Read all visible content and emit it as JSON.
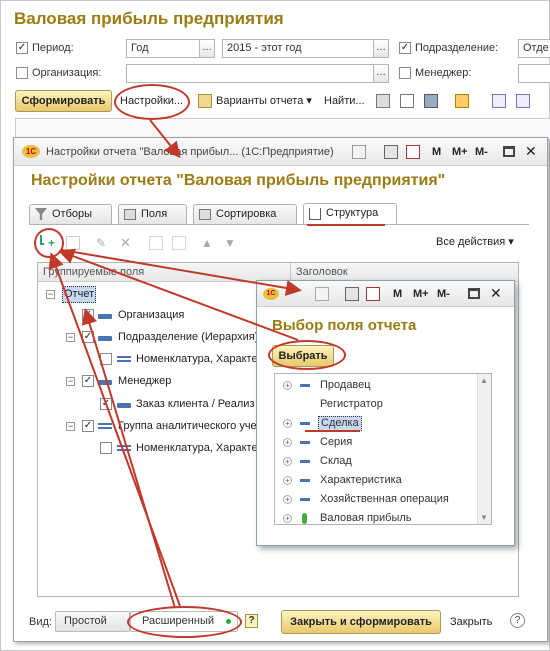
{
  "main": {
    "title": "Валовая прибыль предприятия",
    "period_label": "Период:",
    "period_value": "Год",
    "period_range": "2015 - этот год",
    "division_label": "Подразделение:",
    "division_value": "Отде",
    "org_label": "Организация:",
    "manager_label": "Менеджер:",
    "toolbar": {
      "generate": "Сформировать",
      "settings": "Настройки...",
      "variants": "Варианты отчета",
      "find": "Найти..."
    }
  },
  "settings_window": {
    "titlebar": "Настройки отчета \"Валовая прибыл... (1С:Предприятие)",
    "heading": "Настройки отчета \"Валовая прибыль предприятия\"",
    "tabs": [
      "Отборы",
      "Поля",
      "Сортировка",
      "Структура"
    ],
    "all_actions": "Все действия",
    "columns": {
      "grouped": "Группируемые поля",
      "header": "Заголовок"
    },
    "tree": [
      {
        "label": "Отчет"
      },
      {
        "label": "Организация"
      },
      {
        "label": "Подразделение (Иерархия)"
      },
      {
        "label": "Номенклатура, Характе"
      },
      {
        "label": "Менеджер"
      },
      {
        "label": "Заказ клиента / Реализ"
      },
      {
        "label": "Группа аналитического уче"
      },
      {
        "label": "Номенклатура, Характе"
      }
    ],
    "view_label": "Вид:",
    "view_simple": "Простой",
    "view_extended": "Расширенный",
    "help": "?",
    "close_generate": "Закрыть и сформировать",
    "close": "Закрыть"
  },
  "popup": {
    "heading": "Выбор поля отчета",
    "select_button": "Выбрать",
    "items": [
      "Продавец",
      "Регистратор",
      "Сделка",
      "Серия",
      "Склад",
      "Характеристика",
      "Хозяйственная операция",
      "Валовая прибыль"
    ]
  },
  "window_buttons": {
    "m": "M",
    "mplus": "M+",
    "mminus": "M-"
  },
  "colors": {
    "accent": "#9b7c12",
    "annotation": "#c0392b",
    "button": "#e8c86a",
    "field_icon": "#4a74b0"
  }
}
